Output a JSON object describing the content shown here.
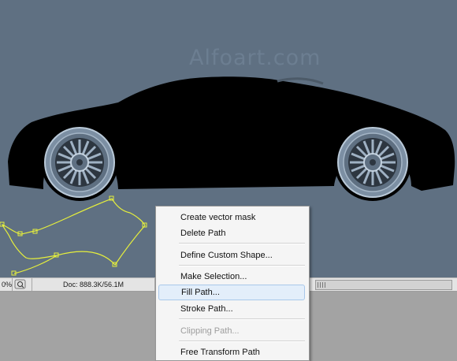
{
  "watermark": "Alfoart.com",
  "status_bar": {
    "zoom": "0%",
    "doc_info": "Doc: 888.3K/56.1M"
  },
  "context_menu": {
    "items": [
      {
        "label": "Create vector mask",
        "enabled": true
      },
      {
        "label": "Delete Path",
        "enabled": true
      },
      {
        "label": "Define Custom Shape...",
        "enabled": true
      },
      {
        "label": "Make Selection...",
        "enabled": true
      },
      {
        "label": "Fill Path...",
        "enabled": true,
        "highlighted": true
      },
      {
        "label": "Stroke Path...",
        "enabled": true
      },
      {
        "label": "Clipping Path...",
        "enabled": false
      },
      {
        "label": "Free Transform Path",
        "enabled": true
      }
    ]
  },
  "colors": {
    "canvas": "#5f7082",
    "car_silhouette": "#000000",
    "path_stroke": "#e6ef3c",
    "menu_highlight": "#e3eefa"
  }
}
